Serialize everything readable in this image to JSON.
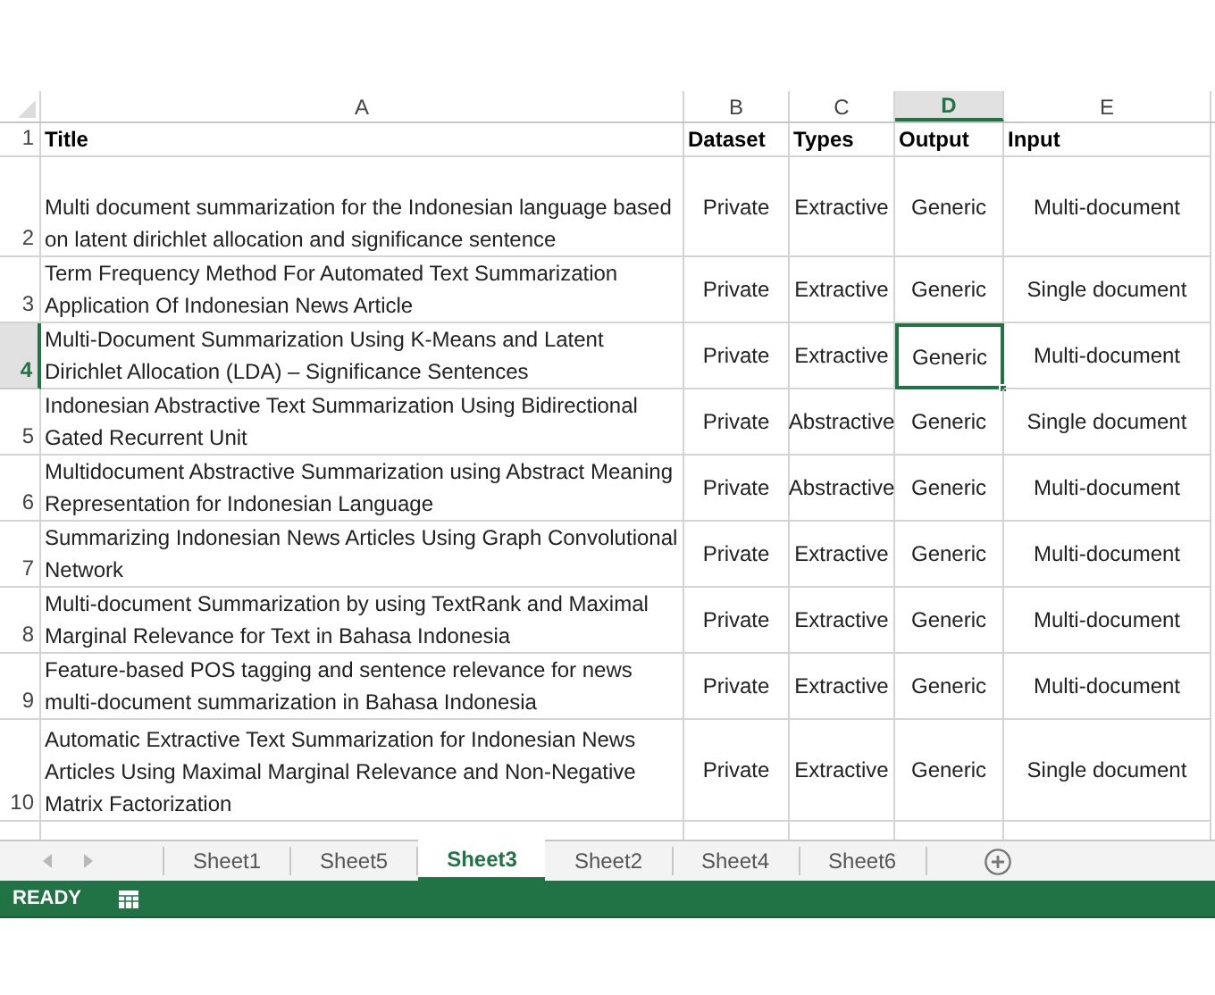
{
  "columns": [
    {
      "label": "A",
      "selected": false
    },
    {
      "label": "B",
      "selected": false
    },
    {
      "label": "C",
      "selected": false
    },
    {
      "label": "D",
      "selected": true
    },
    {
      "label": "E",
      "selected": false
    }
  ],
  "header_row": {
    "number": "1",
    "selected": false,
    "cells": [
      "Title",
      "Dataset",
      "Types",
      "Output",
      "Input"
    ]
  },
  "rows": [
    {
      "number": "2",
      "selected": false,
      "cells": [
        "Multi document summarization for the Indonesian language based on latent dirichlet allocation and significance sentence",
        "Private",
        "Extractive",
        "Generic",
        "Multi-document"
      ]
    },
    {
      "number": "3",
      "selected": false,
      "cells": [
        "Term Frequency Method For Automated Text Summarization Application Of Indonesian News Article",
        "Private",
        "Extractive",
        "Generic",
        "Single document"
      ]
    },
    {
      "number": "4",
      "selected": true,
      "cells": [
        "Multi-Document Summarization Using K-Means and Latent Dirichlet Allocation (LDA) – Significance Sentences",
        "Private",
        "Extractive",
        "Generic",
        "Multi-document"
      ]
    },
    {
      "number": "5",
      "selected": false,
      "cells": [
        "Indonesian Abstractive Text Summarization Using Bidirectional Gated Recurrent Unit",
        "Private",
        "Abstractive",
        "Generic",
        "Single document"
      ]
    },
    {
      "number": "6",
      "selected": false,
      "cells": [
        "Multidocument Abstractive Summarization using Abstract Meaning Representation for Indonesian Language",
        "Private",
        "Abstractive",
        "Generic",
        "Multi-document"
      ]
    },
    {
      "number": "7",
      "selected": false,
      "cells": [
        "Summarizing Indonesian News Articles Using Graph Convolutional Network",
        "Private",
        "Extractive",
        "Generic",
        "Multi-document"
      ]
    },
    {
      "number": "8",
      "selected": false,
      "cells": [
        "Multi-document Summarization by using TextRank and Maximal Marginal Relevance for Text in Bahasa Indonesia",
        "Private",
        "Extractive",
        "Generic",
        "Multi-document"
      ]
    },
    {
      "number": "9",
      "selected": false,
      "cells": [
        "Feature-based POS tagging and sentence relevance for news multi-document summarization in Bahasa Indonesia",
        "Private",
        "Extractive",
        "Generic",
        "Multi-document"
      ]
    },
    {
      "number": "10",
      "selected": false,
      "cells": [
        "Automatic Extractive Text Summarization for Indonesian News Articles Using Maximal Marginal Relevance and Non-Negative Matrix Factorization",
        "Private",
        "Extractive",
        "Generic",
        "Single document"
      ]
    }
  ],
  "sheet_tabs": [
    {
      "label": "Sheet1",
      "selected": false
    },
    {
      "label": "Sheet5",
      "selected": false
    },
    {
      "label": "Sheet3",
      "selected": true
    },
    {
      "label": "Sheet2",
      "selected": false
    },
    {
      "label": "Sheet4",
      "selected": false
    },
    {
      "label": "Sheet6",
      "selected": false
    }
  ],
  "status_bar": {
    "mode": "READY"
  }
}
